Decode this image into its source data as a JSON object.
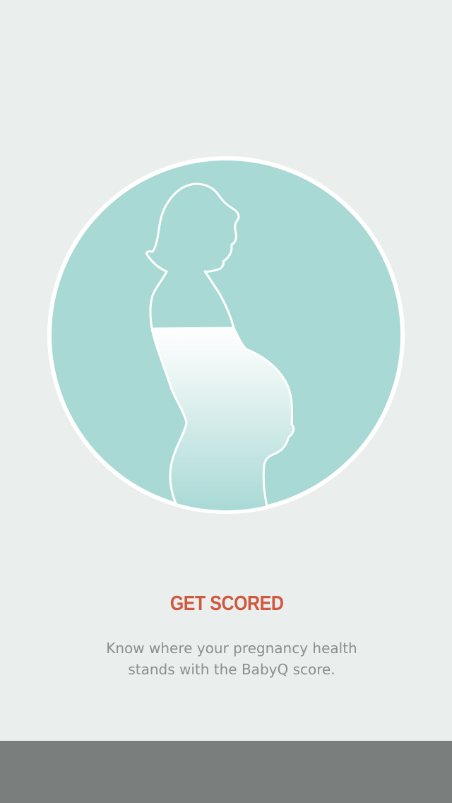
{
  "onboarding": {
    "illustration_icon": "pregnant-woman-silhouette-icon",
    "title": "GET SCORED",
    "description": "Know where your pregnancy health stands with the BabyQ score."
  },
  "colors": {
    "background": "#eaeeec",
    "circle_fill": "#a8d9d5",
    "circle_ring": "#ffffff",
    "title": "#d0583f",
    "description": "#8a8e8c",
    "bottom_bar": "#7a7e7c"
  }
}
